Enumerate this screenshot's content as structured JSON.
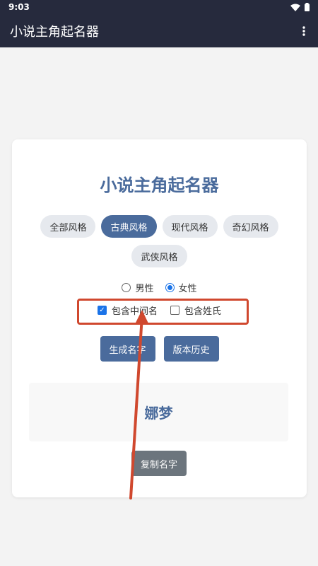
{
  "status_bar": {
    "time": "9:03"
  },
  "app_bar": {
    "title": "小说主角起名器",
    "menu_icon": "more-vert-icon"
  },
  "card": {
    "title": "小说主角起名器",
    "styles": [
      {
        "label": "全部风格",
        "active": false
      },
      {
        "label": "古典风格",
        "active": true
      },
      {
        "label": "现代风格",
        "active": false
      },
      {
        "label": "奇幻风格",
        "active": false
      },
      {
        "label": "武侠风格",
        "active": false
      }
    ],
    "gender": {
      "options": [
        "男性",
        "女性"
      ],
      "selected": "女性"
    },
    "options": [
      {
        "label": "包含中间名",
        "checked": true
      },
      {
        "label": "包含姓氏",
        "checked": false
      }
    ],
    "buttons": {
      "generate": "生成名字",
      "history": "版本历史"
    },
    "result_name": "娜梦",
    "copy_label": "复制名字"
  },
  "colors": {
    "app_bar_bg": "#262a3d",
    "accent": "#4a6b9c",
    "copy_button": "#6c757d",
    "annotation": "#d0482e",
    "control_blue": "#1a73e8"
  }
}
